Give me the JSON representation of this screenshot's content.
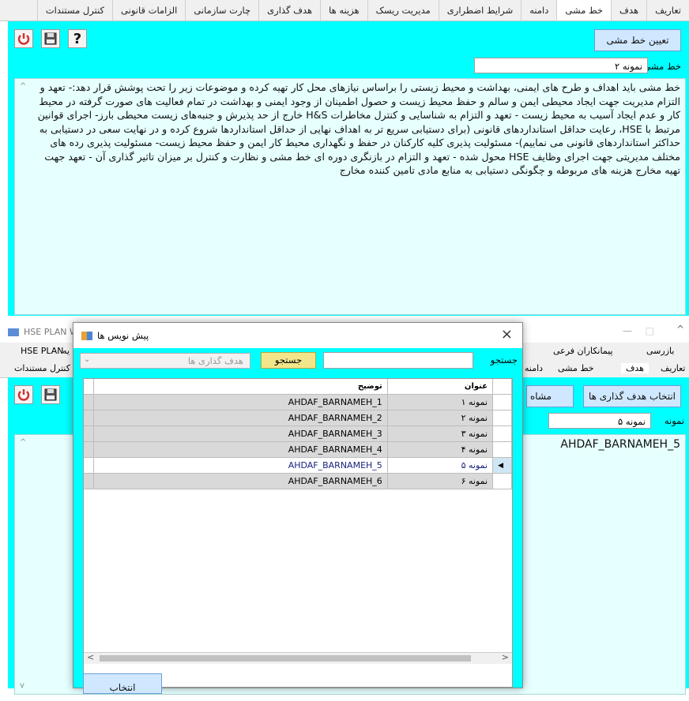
{
  "top": {
    "tabs": [
      "تعاریف",
      "هدف",
      "خط مشی",
      "دامنه",
      "شرایط اضطراری",
      "مدیریت ریسک",
      "هزینه ها",
      "هدف گذاری",
      "چارت سازمانی",
      "الزامات قانونی",
      "کنترل مستندات"
    ],
    "active_tab": "خط مشی",
    "assign_button": "تعیین خط مشی",
    "field_label": "خط مشی",
    "field_value": "نمونه ۲",
    "body_text": "خط مشی باید اهداف و طرح های ایمنی، بهداشت و محیط زیستی را براساس نیازهای محل کار تهیه کرده و موضوعات زیر را تحت پوشش قرار دهد:- تعهد و التزام مدیریت جهت ایجاد محیطی ایمن و سالم و حفظ محیط زیست و حصول اطمینان از وجود ایمنی و بهداشت در تمام فعالیت های صورت گرفته در محیط کار و عدم ایجاد آسیب به محیط زیست - تعهد و التزام به شناسایی و کنترل مخاطرات H&S خارج از حد پذیرش و جنبه‌های زیست محیطی بارز- اجرای قوانین مرتبط با HSE، رعایت حداقل استانداردهای قانونی (برای دستیابی سریع تر به اهداف نهایی از حداقل استانداردها شروع کرده و در نهایت سعی در دستیابی به حداکثر استانداردهای قانونی می نماییم)- مسئولیت پذیری کلیه کارکنان در حفظ و نگهداری محیط کار ایمن و حفظ محیط زیست- مسئولیت پذیری رده های مختلف مدیریتی جهت اجرای وظایف HSE محول شده - تعهد و التزام در بازنگری دوره ای خط مشی و نظارت و کنترل بر میزان تاثیر گذاری آن - تعهد جهت تهیه مخارج هزینه های مربوطه و چگونگی دستیابی به منابع مادی تامین کننده مخارج"
  },
  "bottom": {
    "bg_title": "HSE PLAN W",
    "tabs_row1": [
      "بازرسی",
      "پیمانکاران فرعی"
    ],
    "tabs_row1_left": "HSE PLAN",
    "tabs_row1_left_suffix": "یه",
    "tabs_row2": [
      "تعاریف",
      "هدف",
      "خط مشی",
      "دامنه"
    ],
    "tabs_row2_left": "کنترل مستندات",
    "select_button": "انتخاب هدف گذاری ها",
    "view_button": "مشاه",
    "field_label": "نمونه",
    "field_value": "نمونه ۵",
    "body_value": "AHDAF_BARNAMEH_5"
  },
  "dialog": {
    "title": "پیش نویس ها",
    "close": "×",
    "search_label": "جستجو",
    "search_button": "جستجو",
    "combo_placeholder": "هدف گذاری ها",
    "col_title": "عنوان",
    "col_desc": "توضیح",
    "rows": [
      {
        "title": "نمونه ۱",
        "desc": "AHDAF_BARNAMEH_1"
      },
      {
        "title": "نمونه ۲",
        "desc": "AHDAF_BARNAMEH_2"
      },
      {
        "title": "نمونه ۳",
        "desc": "AHDAF_BARNAMEH_3"
      },
      {
        "title": "نمونه ۴",
        "desc": "AHDAF_BARNAMEH_4"
      },
      {
        "title": "نمونه ۵",
        "desc": "AHDAF_BARNAMEH_5"
      },
      {
        "title": "نمونه ۶",
        "desc": "AHDAF_BARNAMEH_6"
      }
    ],
    "selected_index": 4,
    "ok_button": "انتخاب"
  },
  "colors": {
    "panel": "#00ffff",
    "textarea": "#e6ffff",
    "power": "#d32f2f",
    "selected_text": "#1a237e"
  }
}
